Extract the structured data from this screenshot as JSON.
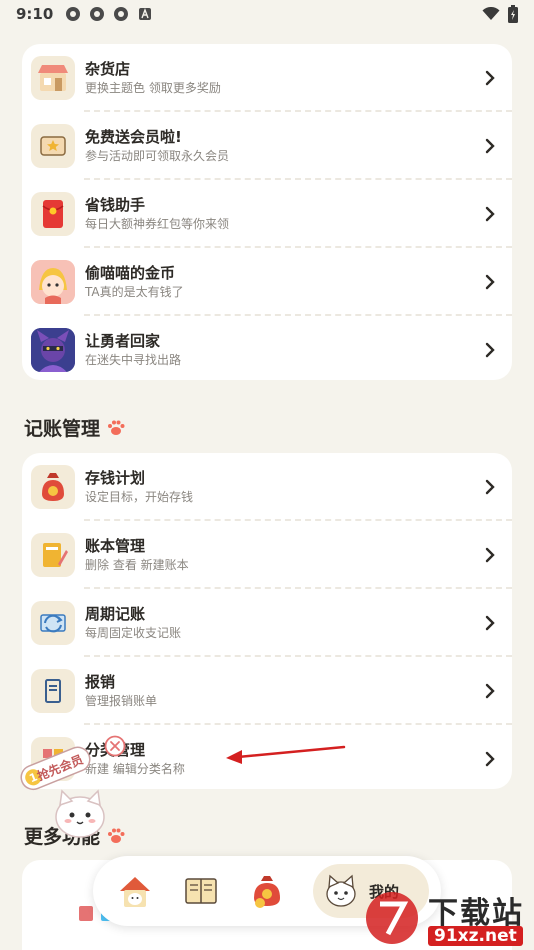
{
  "status": {
    "time": "9:10"
  },
  "section1": {
    "items": [
      {
        "title": "杂货店",
        "sub": "更换主题色 领取更多奖励",
        "icon": "shop-icon"
      },
      {
        "title": "免费送会员啦!",
        "sub": "参与活动即可领取永久会员",
        "icon": "ticket-icon"
      },
      {
        "title": "省钱助手",
        "sub": "每日大额神券红包等你来领",
        "icon": "red-envelope-icon"
      },
      {
        "title": "偷喵喵的金币",
        "sub": "TA真的是太有钱了",
        "icon": "cat-game-icon"
      },
      {
        "title": "让勇者回家",
        "sub": "在迷失中寻找出路",
        "icon": "hero-game-icon"
      }
    ]
  },
  "section2": {
    "title": "记账管理",
    "items": [
      {
        "title": "存钱计划",
        "sub": "设定目标，开始存钱",
        "icon": "money-bag-icon"
      },
      {
        "title": "账本管理",
        "sub": "删除 查看 新建账本",
        "icon": "ledger-icon"
      },
      {
        "title": "周期记账",
        "sub": "每周固定收支记账",
        "icon": "cycle-icon"
      },
      {
        "title": "报销",
        "sub": "管理报销账单",
        "icon": "reimburse-icon"
      },
      {
        "title": "分类管理",
        "sub": "新建 编辑分类名称",
        "icon": "category-icon"
      }
    ]
  },
  "section3": {
    "title": "更多功能"
  },
  "sticker": {
    "label": "抢先会员"
  },
  "nav": {
    "active_label": "我的"
  },
  "watermark": {
    "top": "下载站",
    "bottom": "91xz.net"
  },
  "colors": {
    "background": "#f5f3ec",
    "card": "#ffffff",
    "accent": "#f3ebd9",
    "arrow": "#d42020",
    "paw": "#f36d5a"
  }
}
